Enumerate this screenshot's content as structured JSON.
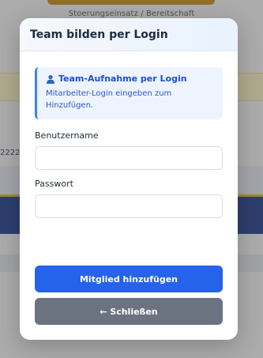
{
  "background": {
    "caption": "Stoerungseinsatz / Bereitschaft",
    "row_text": "2222"
  },
  "modal": {
    "title": "Team bilden per Login",
    "info": {
      "icon": "user-icon",
      "title": "Team-Aufnahme per Login",
      "text": "Mitarbeiter-Login eingeben zum Hinzufügen."
    },
    "username": {
      "label": "Benutzername",
      "value": "",
      "placeholder": ""
    },
    "password": {
      "label": "Passwort",
      "value": "",
      "placeholder": ""
    },
    "add_button": "Mitglied hinzufügen",
    "close_button": "← Schließen"
  },
  "colors": {
    "primary": "#2563eb",
    "secondary": "#6b7280",
    "info_accent": "#3b82f6"
  }
}
